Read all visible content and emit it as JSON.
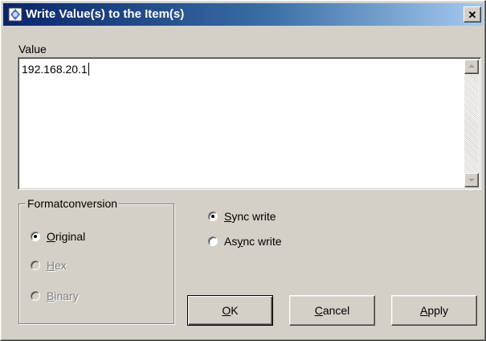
{
  "window": {
    "title": "Write Value(s) to the Item(s)",
    "close_glyph": "✕"
  },
  "value": {
    "label": "Value",
    "text": "192.168.20.1"
  },
  "format_group": {
    "legend": "Formatconversion",
    "options": [
      {
        "pre": "",
        "key": "O",
        "post": "riginal",
        "selected": true,
        "enabled": true
      },
      {
        "pre": "",
        "key": "H",
        "post": "ex",
        "selected": false,
        "enabled": false
      },
      {
        "pre": "",
        "key": "B",
        "post": "inary",
        "selected": false,
        "enabled": false
      }
    ]
  },
  "write_mode": {
    "options": [
      {
        "pre": "",
        "key": "S",
        "post": "ync write",
        "selected": true
      },
      {
        "pre": "As",
        "key": "y",
        "post": "nc write",
        "selected": false
      }
    ]
  },
  "buttons": {
    "ok": {
      "pre": "",
      "key": "O",
      "post": "K"
    },
    "cancel": {
      "pre": "",
      "key": "C",
      "post": "ancel"
    },
    "apply": {
      "pre": "",
      "key": "A",
      "post": "pply"
    }
  },
  "colors": {
    "face": "#d4d0c8",
    "title_start": "#0a246a",
    "title_end": "#a6caf0"
  }
}
